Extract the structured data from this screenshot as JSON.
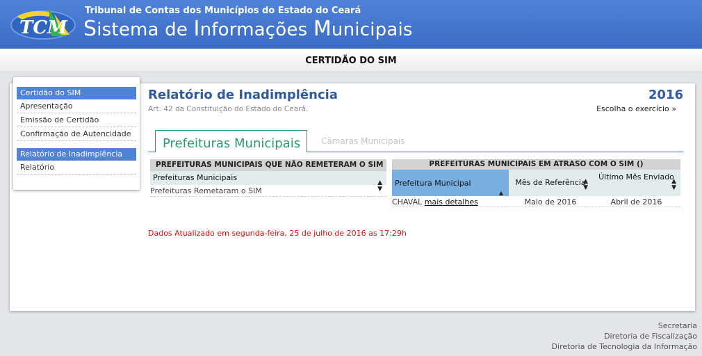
{
  "header": {
    "org_name": "Tribunal de Contas dos Municípios do Estado do Ceará",
    "system_name": "Sistema de Informações Municipais",
    "logo_text": "TCM"
  },
  "page_title": "CERTIDÃO DO SIM",
  "sidebar": {
    "section1_title": "Certidão do SIM",
    "section1_items": [
      "Apresentação",
      "Emissão de Certidão",
      "Confirmação de Autencidade"
    ],
    "section2_title": "Relatório de Inadimplência",
    "section2_items": [
      "Relatório"
    ]
  },
  "report": {
    "title": "Relatório de Inadimplência",
    "subtitle": "Art. 42 da Constituição do Estado do Ceará.",
    "year": "2016",
    "choose_year": "Escolha o exercício »"
  },
  "tabs": {
    "active": "Prefeituras Municipais",
    "inactive": "Câmaras Municipais"
  },
  "left_table": {
    "title": "PREFEITURAS MUNICIPAIS QUE NÃO REMETERAM O SIM (0)",
    "header": "Prefeituras Municipais",
    "rows": [
      "Prefeituras Remetaram o SIM"
    ]
  },
  "right_table": {
    "title": "PREFEITURAS MUNICIPAIS EM ATRASO COM O SIM ()",
    "headers": [
      "Prefeitura Municipal",
      "Mês de Referência",
      "Último Mês Enviado"
    ],
    "rows": [
      {
        "municipio": "CHAVAL",
        "link": "mais detalhes",
        "mes_referencia": "Maio de 2016",
        "ultimo_enviado": "Abril de 2016"
      }
    ]
  },
  "updated_text": "Dados Atualizado em segunda-feira, 25 de julho de 2016 as 17:29h",
  "footer": [
    "Secretaria",
    "Diretoria de Fiscalização",
    "Diretoria de Tecnologia da Informação"
  ],
  "colors": {
    "header_blue": "#3b6cc6",
    "tab_green": "#2b9a6c",
    "alert_red": "#cc1111",
    "sort_active": "#79aee0"
  }
}
